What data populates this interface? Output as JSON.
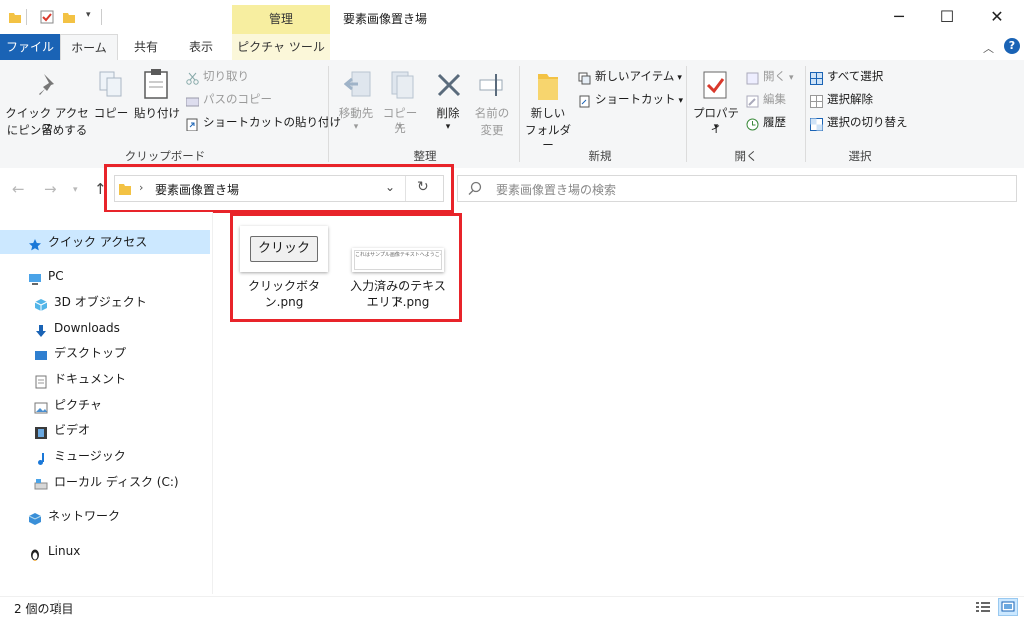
{
  "window": {
    "title": "要素画像置き場",
    "contextual_tab_group": "管理",
    "controls": {
      "minimize": "─",
      "maximize": "☐",
      "close": "✕"
    }
  },
  "ribbon_tabs": {
    "file": "ファイル",
    "home": "ホーム",
    "share": "共有",
    "view": "表示",
    "picture_tools": "ピクチャ ツール",
    "active": "ホーム"
  },
  "ribbon": {
    "clipboard": {
      "group_label": "クリップボード",
      "pin_quick_access": [
        "クイック アクセス",
        "にピン留めする"
      ],
      "copy": "コピー",
      "paste": "貼り付け",
      "cut": "切り取り",
      "copy_path": "パスのコピー",
      "paste_shortcut": "ショートカットの貼り付け"
    },
    "organize": {
      "group_label": "整理",
      "move_to": "移動先",
      "copy_to": "コピー先",
      "delete": "削除",
      "rename": [
        "名前の",
        "変更"
      ]
    },
    "new": {
      "group_label": "新規",
      "new_folder": [
        "新しい",
        "フォルダー"
      ],
      "new_item": "新しいアイテム",
      "easy_access": "ショートカット"
    },
    "open": {
      "group_label": "開く",
      "properties": "プロパティ",
      "open": "開く",
      "edit": "編集",
      "history": "履歴"
    },
    "select": {
      "group_label": "選択",
      "select_all": "すべて選択",
      "select_none": "選択解除",
      "invert_selection": "選択の切り替え"
    }
  },
  "address_bar": {
    "path": "要素画像置き場",
    "search_placeholder": "要素画像置き場の検索"
  },
  "nav_pane": {
    "items": [
      {
        "label": "クイック アクセス",
        "icon": "star-icon",
        "selected": true
      },
      {
        "label": "PC",
        "icon": "computer-icon"
      },
      {
        "label": "3D オブジェクト",
        "icon": "3d-objects-icon"
      },
      {
        "label": "Downloads",
        "icon": "download-arrow-icon"
      },
      {
        "label": "デスクトップ",
        "icon": "desktop-icon"
      },
      {
        "label": "ドキュメント",
        "icon": "document-icon"
      },
      {
        "label": "ピクチャ",
        "icon": "pictures-icon"
      },
      {
        "label": "ビデオ",
        "icon": "video-icon"
      },
      {
        "label": "ミュージック",
        "icon": "music-note-icon"
      },
      {
        "label": "ローカル ディスク (C:)",
        "icon": "drive-icon"
      },
      {
        "label": "ネットワーク",
        "icon": "network-icon"
      },
      {
        "label": "Linux",
        "icon": "penguin-icon"
      }
    ]
  },
  "files": [
    {
      "name": "クリックボタン.png",
      "thumb_text": "クリック"
    },
    {
      "name": "入力済みのテキストエリア.png",
      "name_lines": [
        "入力済みのテキスト",
        "エリア.png"
      ],
      "thumb_text": "これはサンプル画像テキストへようこそ"
    }
  ],
  "status_bar": {
    "item_count": "2 個の項目"
  },
  "colors": {
    "accent": "#1a63b5",
    "highlight_frame": "#e8242a",
    "manage_tab": "#f7eea0",
    "nav_selected": "#cce8ff"
  }
}
